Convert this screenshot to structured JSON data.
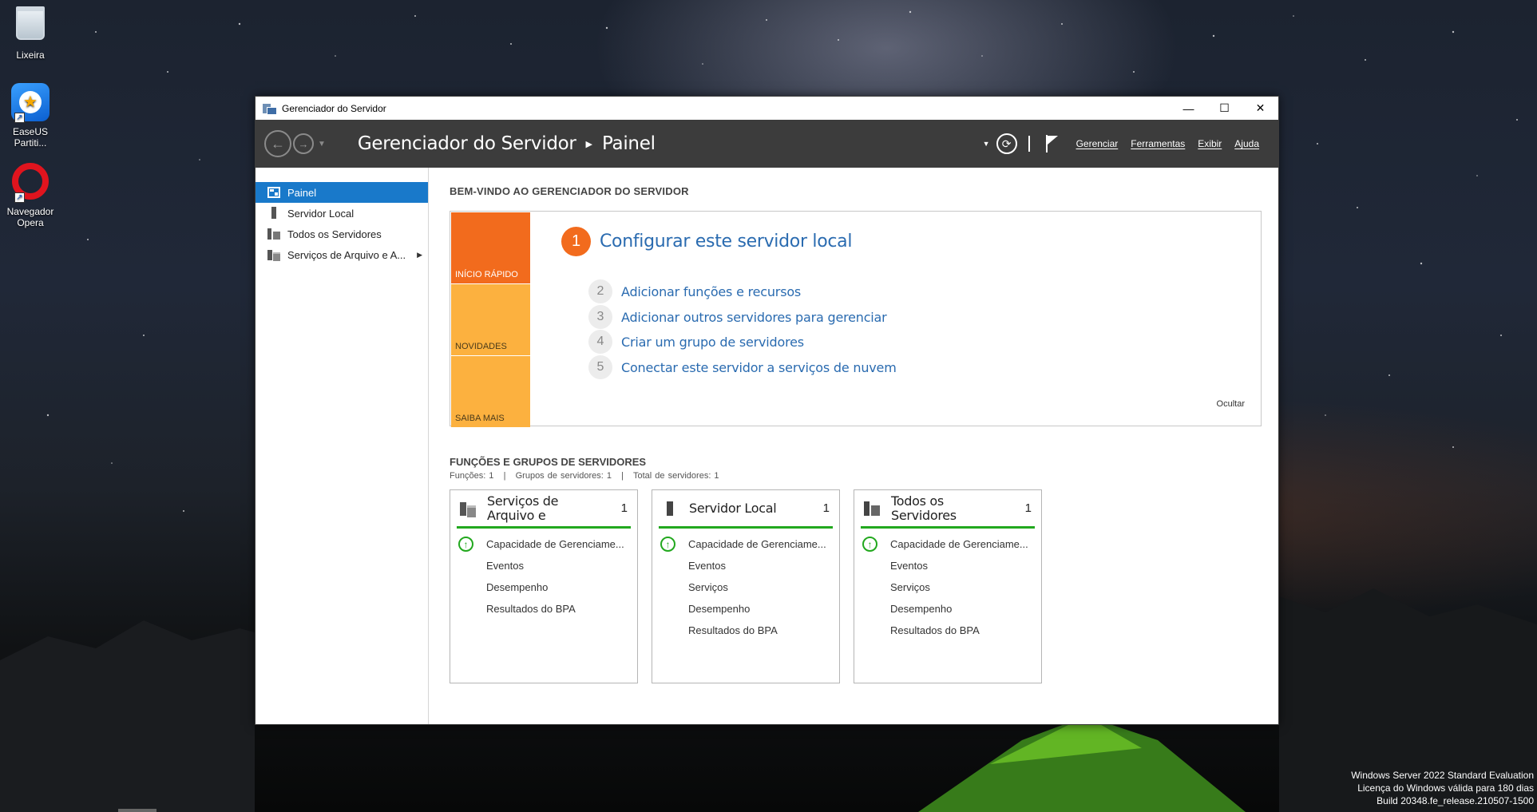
{
  "desktop": {
    "icons": [
      {
        "label": "Lixeira"
      },
      {
        "label": "EaseUS Partiti..."
      },
      {
        "label": "Navegador Opera"
      }
    ],
    "watermark": [
      "Windows Server 2022 Standard Evaluation",
      "Licença do Windows válida para 180 dias",
      "Build 20348.fe_release.210507-1500"
    ]
  },
  "window": {
    "title": "Gerenciador do Servidor",
    "controls": {
      "minimize": "—",
      "maximize": "☐",
      "close": "✕"
    },
    "breadcrumb": {
      "root": "Gerenciador do Servidor",
      "current": "Painel"
    },
    "menu": [
      "Gerenciar",
      "Ferramentas",
      "Exibir",
      "Ajuda"
    ]
  },
  "sidebar": {
    "items": [
      {
        "label": "Painel",
        "icon": "dashboard-icon",
        "active": true
      },
      {
        "label": "Servidor Local",
        "icon": "server-icon"
      },
      {
        "label": "Todos os Servidores",
        "icon": "all-servers-icon"
      },
      {
        "label": "Serviços de Arquivo e A...",
        "icon": "file-services-icon",
        "has_children": true
      }
    ]
  },
  "welcome": {
    "title": "BEM-VINDO AO GERENCIADOR DO SERVIDOR",
    "tiles": [
      "INÍCIO RÁPIDO",
      "NOVIDADES",
      "SAIBA MAIS"
    ],
    "step1": {
      "num": "1",
      "text": "Configurar este servidor local"
    },
    "steps": [
      {
        "num": "2",
        "text": "Adicionar funções e recursos"
      },
      {
        "num": "3",
        "text": "Adicionar outros servidores para gerenciar"
      },
      {
        "num": "4",
        "text": "Criar um grupo de servidores"
      },
      {
        "num": "5",
        "text": "Conectar este servidor a serviços de nuvem"
      }
    ],
    "hide": "Ocultar"
  },
  "roles": {
    "title": "FUNÇÕES E GRUPOS DE SERVIDORES",
    "stats": "Funções: 1   |   Grupos de servidores: 1   |   Total de servidores: 1",
    "cards": [
      {
        "title": "Serviços de Arquivo e Armazenamento",
        "count": "1",
        "rows": [
          "Capacidade de Gerenciame...",
          "Eventos",
          "Desempenho",
          "Resultados do BPA"
        ]
      },
      {
        "title": "Servidor Local",
        "count": "1",
        "rows": [
          "Capacidade de Gerenciame...",
          "Eventos",
          "Serviços",
          "Desempenho",
          "Resultados do BPA"
        ]
      },
      {
        "title": "Todos os Servidores",
        "count": "1",
        "rows": [
          "Capacidade de Gerenciame...",
          "Eventos",
          "Serviços",
          "Desempenho",
          "Resultados do BPA"
        ]
      }
    ]
  },
  "colors": {
    "accent": "#1979ca",
    "quickstart": "#f26b1d",
    "tiles": "#fcb13f",
    "status_ok": "#22a81e",
    "toolbar": "#3c3c3c"
  }
}
